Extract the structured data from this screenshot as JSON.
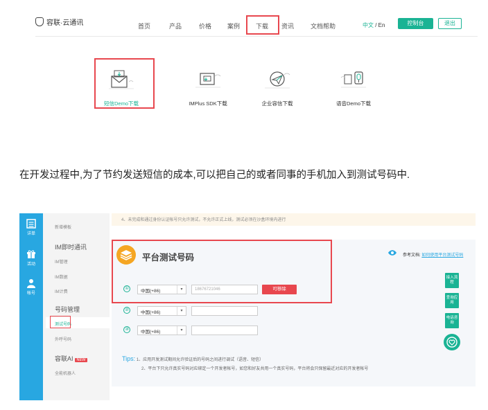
{
  "header": {
    "brand": "容联·云通讯",
    "nav": [
      "首页",
      "产品",
      "价格",
      "案例",
      "下载",
      "资讯",
      "文档帮助"
    ],
    "active_nav": "下载",
    "lang_zh": "中文",
    "lang_sep": " / ",
    "lang_en": "En",
    "console_label": "控制台",
    "logout_label": "退出"
  },
  "downloads": [
    {
      "label": "短信Demo下载",
      "icon": "sms-envelope-icon"
    },
    {
      "label": "IMPlus SDK下载",
      "icon": "chat-box-icon"
    },
    {
      "label": "企业容信下载",
      "icon": "paper-plane-icon"
    },
    {
      "label": "语音Demo下载",
      "icon": "microphone-icon"
    }
  ],
  "paragraph": "在开发过程中,为了节约发送短信的成本,可以把自己的或者同事的手机加入到测试号码中.",
  "console": {
    "leftbar": [
      {
        "label": "详单",
        "icon": "list-icon"
      },
      {
        "label": "活动",
        "icon": "gift-icon"
      },
      {
        "label": "帐号",
        "icon": "user-icon"
      }
    ],
    "menu": {
      "top_item": "新增模板",
      "im_group": "IM即时通讯",
      "im_items": [
        "IM管理",
        "IM数据",
        "IM计费"
      ],
      "number_group": "号码管理",
      "number_items": [
        "测试号码",
        "外呼号码"
      ],
      "ai_group": "容联AI",
      "ai_badge": "NEW",
      "ai_items": [
        "全能机器人"
      ]
    },
    "notice": "4、未完成和通过身份认证帐号只允许测试，不允许正式上线，测试必须在沙盒环境内进行",
    "title": "平台测试号码",
    "ref_label": "参考文档:",
    "ref_link": "如何使用平台测试号码",
    "rows": [
      {
        "num": "①",
        "country": "中国(+86)",
        "phone": "18676721046",
        "verify": "可移除"
      },
      {
        "num": "②",
        "country": "中国(+86)",
        "phone": "",
        "verify": ""
      },
      {
        "num": "③",
        "country": "中国(+86)",
        "phone": "",
        "verify": ""
      }
    ],
    "side_buttons": [
      "接入流程",
      "查询应用",
      "电话咨询"
    ],
    "tips_label": "Tips:",
    "tips": [
      "1、应用开发测试期间允许验证后的号码之间进行调试（语音、短信）",
      "2、平台下只允许真实号码对应绑定一个开发者帐号，如您和好友共用一个真实号码，平台将会只保留最近对应的开发者帐号"
    ]
  },
  "colors": {
    "accent": "#1ab394",
    "red": "#e8474e",
    "blue": "#28a7e1"
  }
}
